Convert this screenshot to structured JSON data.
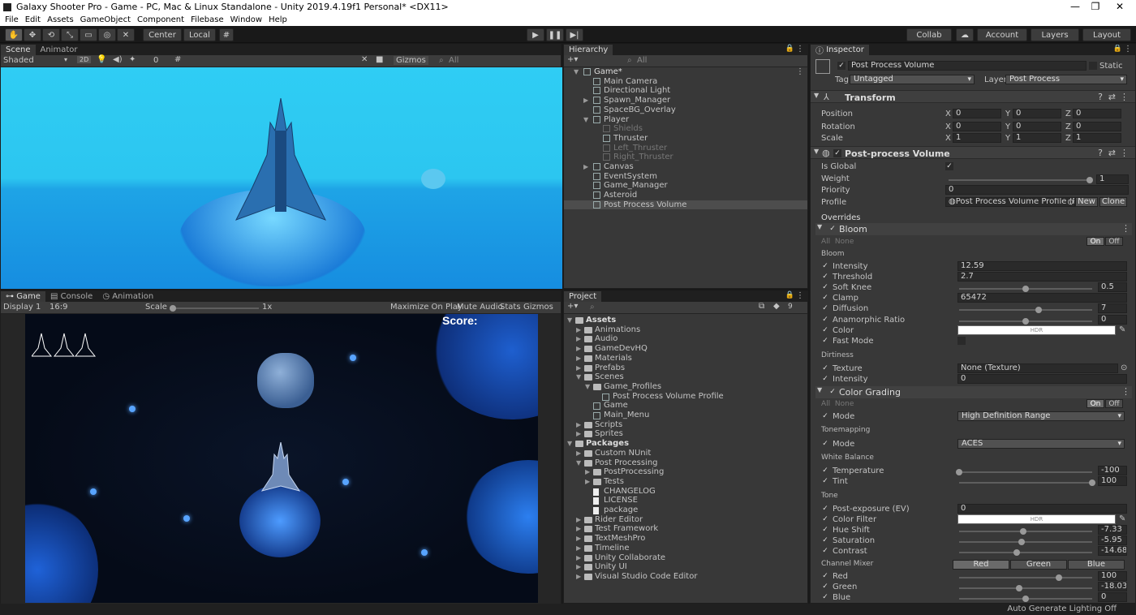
{
  "window": {
    "title": "Galaxy Shooter Pro - Game - PC, Mac & Linux Standalone - Unity 2019.4.19f1 Personal* <DX11>",
    "minimize": "—",
    "maximize": "❐",
    "close": "✕"
  },
  "menu": [
    "File",
    "Edit",
    "Assets",
    "GameObject",
    "Component",
    "Filebase",
    "Window",
    "Help"
  ],
  "toolbar": {
    "center": "Center",
    "local": "Local",
    "collab": "Collab",
    "account": "Account",
    "layers": "Layers",
    "layout": "Layout"
  },
  "scene": {
    "tabs": [
      "Scene",
      "Animator"
    ],
    "shading": "Shaded",
    "mode2d": "2D",
    "hidden_count": "0",
    "gizmos": "Gizmos",
    "search_placeholder": "All"
  },
  "hierarchy": {
    "tab": "Hierarchy",
    "search_placeholder": "All",
    "items": [
      {
        "label": "Game*",
        "depth": 0,
        "fold": "▼",
        "kind": "scene"
      },
      {
        "label": "Main Camera",
        "depth": 1,
        "fold": "",
        "kind": "obj"
      },
      {
        "label": "Directional Light",
        "depth": 1,
        "fold": "",
        "kind": "obj"
      },
      {
        "label": "Spawn_Manager",
        "depth": 1,
        "fold": "▶",
        "kind": "obj"
      },
      {
        "label": "SpaceBG_Overlay",
        "depth": 1,
        "fold": "",
        "kind": "obj"
      },
      {
        "label": "Player",
        "depth": 1,
        "fold": "▼",
        "kind": "obj"
      },
      {
        "label": "Shields",
        "depth": 2,
        "fold": "",
        "kind": "dim"
      },
      {
        "label": "Thruster",
        "depth": 2,
        "fold": "",
        "kind": "obj"
      },
      {
        "label": "Left_Thruster",
        "depth": 2,
        "fold": "",
        "kind": "dim"
      },
      {
        "label": "Right_Thruster",
        "depth": 2,
        "fold": "",
        "kind": "dim"
      },
      {
        "label": "Canvas",
        "depth": 1,
        "fold": "▶",
        "kind": "obj"
      },
      {
        "label": "EventSystem",
        "depth": 1,
        "fold": "",
        "kind": "obj"
      },
      {
        "label": "Game_Manager",
        "depth": 1,
        "fold": "",
        "kind": "obj"
      },
      {
        "label": "Asteroid",
        "depth": 1,
        "fold": "",
        "kind": "obj"
      },
      {
        "label": "Post Process Volume",
        "depth": 1,
        "fold": "",
        "kind": "sel"
      }
    ]
  },
  "game": {
    "tabs": [
      "Game",
      "Console",
      "Animation"
    ],
    "display": "Display 1",
    "aspect": "16:9",
    "scale_label": "Scale",
    "scale_value": "1x",
    "maximize": "Maximize On Play",
    "mute": "Mute Audio",
    "stats": "Stats",
    "gizmos": "Gizmos",
    "score": "Score:"
  },
  "project": {
    "tab": "Project",
    "badge": "9",
    "items": [
      {
        "label": "Assets",
        "depth": 0,
        "kind": "folder",
        "fold": "▼",
        "bold": true
      },
      {
        "label": "Animations",
        "depth": 1,
        "kind": "folder",
        "fold": "▶"
      },
      {
        "label": "Audio",
        "depth": 1,
        "kind": "folder",
        "fold": "▶"
      },
      {
        "label": "GameDevHQ",
        "depth": 1,
        "kind": "folder",
        "fold": "▶"
      },
      {
        "label": "Materials",
        "depth": 1,
        "kind": "folder",
        "fold": "▶"
      },
      {
        "label": "Prefabs",
        "depth": 1,
        "kind": "folder",
        "fold": "▶"
      },
      {
        "label": "Scenes",
        "depth": 1,
        "kind": "folder",
        "fold": "▼"
      },
      {
        "label": "Game_Profiles",
        "depth": 2,
        "kind": "folder",
        "fold": "▼"
      },
      {
        "label": "Post Process Volume Profile",
        "depth": 3,
        "kind": "asset",
        "fold": ""
      },
      {
        "label": "Game",
        "depth": 2,
        "kind": "unity",
        "fold": ""
      },
      {
        "label": "Main_Menu",
        "depth": 2,
        "kind": "unity",
        "fold": ""
      },
      {
        "label": "Scripts",
        "depth": 1,
        "kind": "folder",
        "fold": "▶"
      },
      {
        "label": "Sprites",
        "depth": 1,
        "kind": "folder",
        "fold": "▶"
      },
      {
        "label": "Packages",
        "depth": 0,
        "kind": "folder",
        "fold": "▼",
        "bold": true
      },
      {
        "label": "Custom NUnit",
        "depth": 1,
        "kind": "folder",
        "fold": "▶"
      },
      {
        "label": "Post Processing",
        "depth": 1,
        "kind": "folder",
        "fold": "▼"
      },
      {
        "label": "PostProcessing",
        "depth": 2,
        "kind": "folder",
        "fold": "▶"
      },
      {
        "label": "Tests",
        "depth": 2,
        "kind": "folder",
        "fold": "▶"
      },
      {
        "label": "CHANGELOG",
        "depth": 2,
        "kind": "file",
        "fold": ""
      },
      {
        "label": "LICENSE",
        "depth": 2,
        "kind": "file",
        "fold": ""
      },
      {
        "label": "package",
        "depth": 2,
        "kind": "file",
        "fold": ""
      },
      {
        "label": "Rider Editor",
        "depth": 1,
        "kind": "folder",
        "fold": "▶"
      },
      {
        "label": "Test Framework",
        "depth": 1,
        "kind": "folder",
        "fold": "▶"
      },
      {
        "label": "TextMeshPro",
        "depth": 1,
        "kind": "folder",
        "fold": "▶"
      },
      {
        "label": "Timeline",
        "depth": 1,
        "kind": "folder",
        "fold": "▶"
      },
      {
        "label": "Unity Collaborate",
        "depth": 1,
        "kind": "folder",
        "fold": "▶"
      },
      {
        "label": "Unity UI",
        "depth": 1,
        "kind": "folder",
        "fold": "▶"
      },
      {
        "label": "Visual Studio Code Editor",
        "depth": 1,
        "kind": "folder",
        "fold": "▶"
      }
    ]
  },
  "inspector": {
    "tab": "Inspector",
    "object_name": "Post Process Volume",
    "static": "Static",
    "tag_label": "Tag",
    "tag": "Untagged",
    "layer_label": "Layer",
    "layer": "Post Process",
    "transform": {
      "title": "Transform",
      "position": "Position",
      "rotation": "Rotation",
      "scale": "Scale",
      "x": "X",
      "y": "Y",
      "z": "Z",
      "pos": [
        "0",
        "0",
        "0"
      ],
      "rot": [
        "0",
        "0",
        "0"
      ],
      "scl": [
        "1",
        "1",
        "1"
      ]
    },
    "ppv": {
      "title": "Post-process Volume",
      "is_global": "Is Global",
      "weight": "Weight",
      "weight_val": "1",
      "weight_frac": 1.0,
      "priority": "Priority",
      "priority_val": "0",
      "profile": "Profile",
      "profile_val": "Post Process Volume Profile (Pos",
      "new": "New",
      "clone": "Clone"
    },
    "overrides": "Overrides",
    "on": "On",
    "off": "Off",
    "none": "None",
    "bloom": {
      "title": "Bloom",
      "group": "Bloom",
      "rows": [
        {
          "label": "Intensity",
          "value": "12.59",
          "type": "field"
        },
        {
          "label": "Threshold",
          "value": "2.7",
          "type": "field"
        },
        {
          "label": "Soft Knee",
          "value": "0.5",
          "type": "slider",
          "frac": 0.5
        },
        {
          "label": "Clamp",
          "value": "65472",
          "type": "field"
        },
        {
          "label": "Diffusion",
          "value": "7",
          "type": "slider",
          "frac": 0.6
        },
        {
          "label": "Anamorphic Ratio",
          "value": "0",
          "type": "slider",
          "frac": 0.5
        },
        {
          "label": "Color",
          "value": "HDR",
          "type": "color"
        },
        {
          "label": "Fast Mode",
          "value": "",
          "type": "check"
        }
      ],
      "dirt_group": "Dirtiness",
      "dirt_rows": [
        {
          "label": "Texture",
          "value": "None (Texture)",
          "type": "obj"
        },
        {
          "label": "Intensity",
          "value": "0",
          "type": "field"
        }
      ]
    },
    "color_grading": {
      "title": "Color Grading",
      "mode_label": "Mode",
      "mode": "High Definition Range",
      "tonemapping": "Tonemapping",
      "tm_mode": "ACES",
      "white_balance": "White Balance",
      "temperature": "Temperature",
      "temperature_val": "-100",
      "temperature_frac": 0.0,
      "tint": "Tint",
      "tint_val": "100",
      "tint_frac": 1.0,
      "tone": "Tone",
      "post_exposure": "Post-exposure (EV)",
      "post_exposure_val": "0",
      "color_filter": "Color Filter",
      "color_filter_val": "HDR",
      "hue_shift": "Hue Shift",
      "hue_shift_val": "-7.33",
      "hue_shift_frac": 0.48,
      "saturation": "Saturation",
      "saturation_val": "-5.95",
      "saturation_frac": 0.47,
      "contrast": "Contrast",
      "contrast_val": "-14.68",
      "contrast_frac": 0.43,
      "channel_mixer": "Channel Mixer",
      "red_btn": "Red",
      "green_btn": "Green",
      "blue_btn": "Blue",
      "red": "Red",
      "red_val": "100",
      "red_frac": 0.75,
      "green": "Green",
      "green_val": "-18.03",
      "green_frac": 0.45,
      "blue": "Blue",
      "blue_val": "0",
      "blue_frac": 0.5
    }
  },
  "status": {
    "text": "Auto Generate Lighting Off"
  }
}
